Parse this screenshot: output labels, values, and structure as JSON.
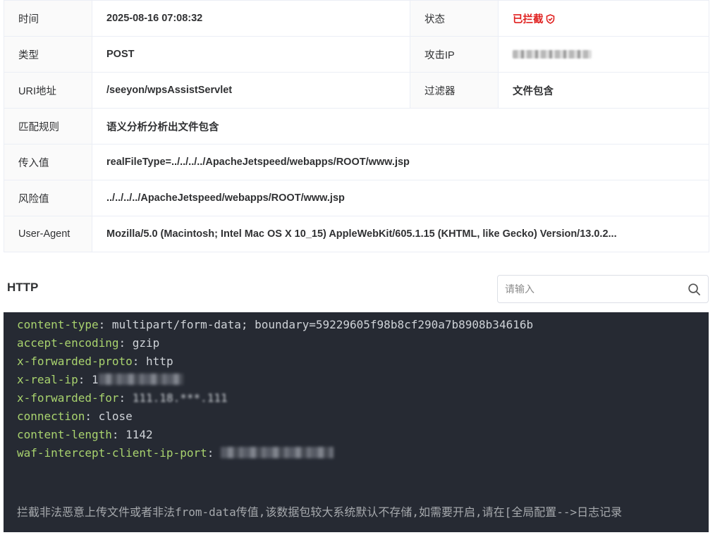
{
  "info": {
    "time_label": "时间",
    "time_value": "2025-08-16 07:08:32",
    "status_label": "状态",
    "status_value": "已拦截",
    "type_label": "类型",
    "type_value": "POST",
    "attack_ip_label": "攻击IP",
    "uri_label": "URI地址",
    "uri_value": "/seeyon/wpsAssistServlet",
    "filter_label": "过滤器",
    "filter_value": "文件包含",
    "rule_label": "匹配规则",
    "rule_value": "语义分析分析出文件包含",
    "input_label": "传入值",
    "input_value": "realFileType=../../../../ApacheJetspeed/webapps/ROOT/www.jsp",
    "risk_label": "风险值",
    "risk_value": "../../../../ApacheJetspeed/webapps/ROOT/www.jsp",
    "ua_label": "User-Agent",
    "ua_value": "Mozilla/5.0 (Macintosh; Intel Mac OS X 10_15) AppleWebKit/605.1.15 (KHTML, like Gecko) Version/13.0.2..."
  },
  "http": {
    "title": "HTTP",
    "search_placeholder": "请输入",
    "headers": [
      {
        "key": "content-type",
        "value": " multipart/form-data; boundary=59229605f98b8cf290a7b8908b34616b"
      },
      {
        "key": "accept-encoding",
        "value": " gzip"
      },
      {
        "key": "x-forwarded-proto",
        "value": " http"
      },
      {
        "key": "x-real-ip",
        "value": " 1"
      },
      {
        "key": "x-forwarded-for",
        "value": " 111.18.***.111"
      },
      {
        "key": "connection",
        "value": " close"
      },
      {
        "key": "content-length",
        "value": " 1142"
      },
      {
        "key": "waf-intercept-client-ip-port",
        "value": " "
      }
    ],
    "notice": "拦截非法恶意上传文件或者非法from-data传值,该数据包较大系统默认不存储,如需要开启,请在[全局配置-->日志记录"
  },
  "colors": {
    "status_red": "#e0201f",
    "header_key": "#a9d36e",
    "code_bg": "#262a33"
  }
}
